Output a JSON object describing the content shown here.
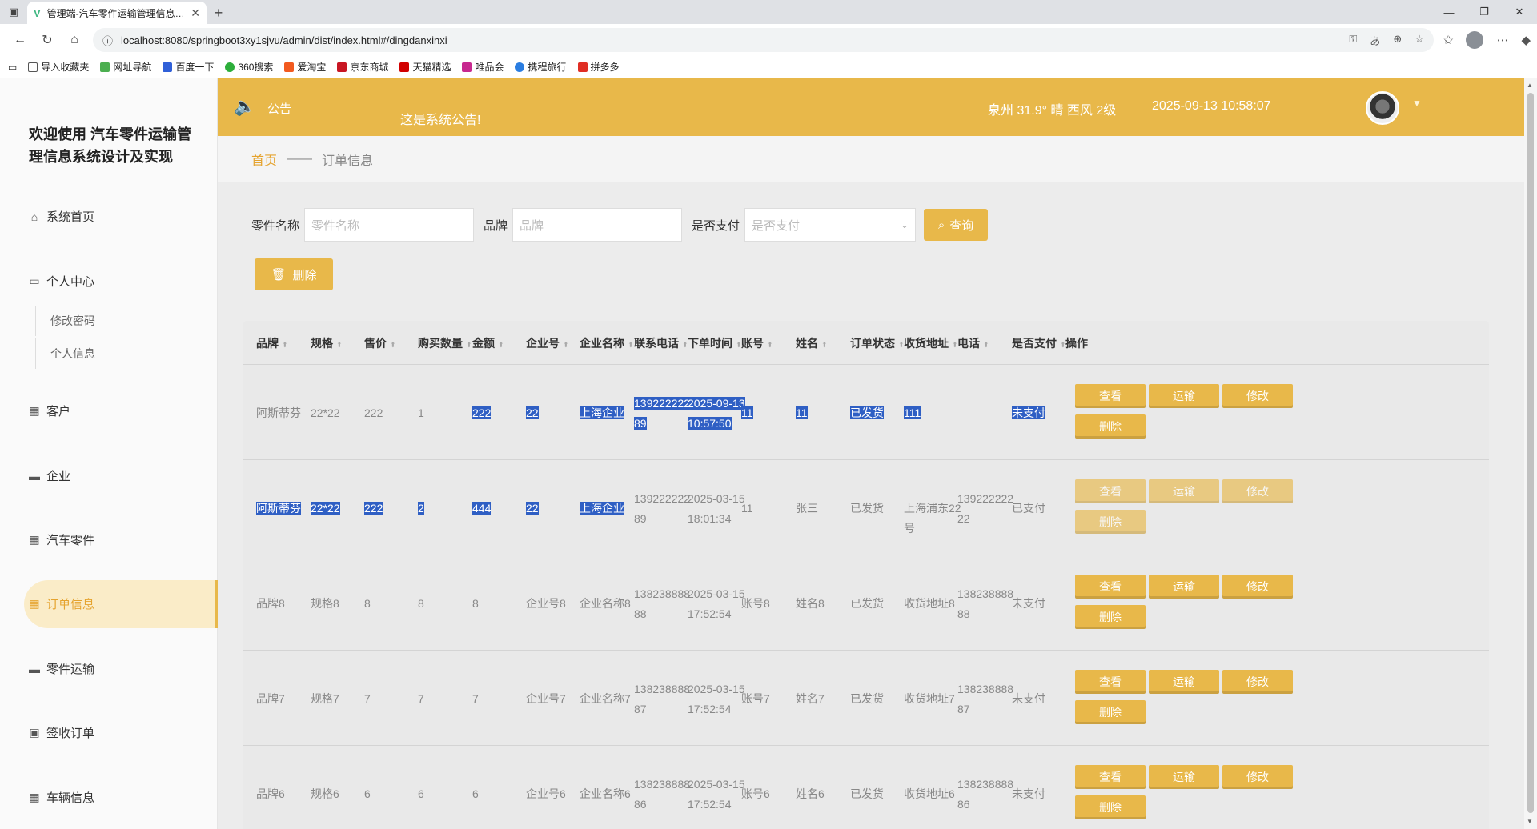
{
  "browser": {
    "tab_title": "管理端-汽车零件运输管理信息系统",
    "url": "localhost:8080/springboot3xy1sjvu/admin/dist/index.html#/dingdanxinxi",
    "bookmarks": [
      "导入收藏夹",
      "网址导航",
      "百度一下",
      "360搜索",
      "爱淘宝",
      "京东商城",
      "天猫精选",
      "唯品会",
      "携程旅行",
      "拼多多"
    ]
  },
  "sidebar": {
    "brand": "欢迎使用 汽车零件运输管理信息系统设计及实现",
    "home": "系统首页",
    "personal": "个人中心",
    "sub": [
      "修改密码",
      "个人信息"
    ],
    "items": [
      "客户",
      "企业",
      "汽车零件",
      "订单信息",
      "零件运输",
      "签收订单",
      "车辆信息"
    ]
  },
  "topbar": {
    "notice_label": "公告",
    "notice_text": "这是系统公告!",
    "weather": "泉州  31.9°  晴  西风  2级",
    "datetime": "2025-09-13 10:58:07"
  },
  "breadcrumb": {
    "home": "首页",
    "sep": "——",
    "current": "订单信息"
  },
  "search": {
    "part_label": "零件名称",
    "part_placeholder": "零件名称",
    "brand_label": "品牌",
    "brand_placeholder": "品牌",
    "paid_label": "是否支付",
    "paid_placeholder": "是否支付",
    "query_btn": "查询",
    "delete_btn": "删除"
  },
  "table": {
    "columns": [
      "品牌",
      "规格",
      "售价",
      "购买数量",
      "金额",
      "企业号",
      "企业名称",
      "联系电话",
      "下单时间",
      "账号",
      "姓名",
      "订单状态",
      "收货地址",
      "电话",
      "是否支付",
      "操作"
    ],
    "rows": [
      [
        "阿斯蒂芬",
        "22*22",
        "222",
        "1",
        "222",
        "22",
        "上海企业",
        "13922222289",
        "2025-09-13 10:57:50",
        "11",
        "11",
        "已发货",
        "111",
        "",
        "未支付"
      ],
      [
        "阿斯蒂芬",
        "22*22",
        "222",
        "2",
        "444",
        "22",
        "上海企业",
        "13922222289",
        "2025-03-15 18:01:34",
        "11",
        "张三",
        "已发货",
        "上海浦东22号",
        "13922222222",
        "已支付"
      ],
      [
        "品牌8",
        "规格8",
        "8",
        "8",
        "8",
        "企业号8",
        "企业名称8",
        "13823888888",
        "2025-03-15 17:52:54",
        "账号8",
        "姓名8",
        "已发货",
        "收货地址8",
        "13823888888",
        "未支付"
      ],
      [
        "品牌7",
        "规格7",
        "7",
        "7",
        "7",
        "企业号7",
        "企业名称7",
        "13823888887",
        "2025-03-15 17:52:54",
        "账号7",
        "姓名7",
        "已发货",
        "收货地址7",
        "13823888887",
        "未支付"
      ],
      [
        "品牌6",
        "规格6",
        "6",
        "6",
        "6",
        "企业号6",
        "企业名称6",
        "13823888886",
        "2025-03-15 17:52:54",
        "账号6",
        "姓名6",
        "已发货",
        "收货地址6",
        "13823888886",
        "未支付"
      ]
    ],
    "actions": [
      "查看",
      "运输",
      "修改",
      "删除"
    ]
  },
  "colors": {
    "accent": "#e8b84a",
    "selection": "#2f5fc4",
    "active_menu_bg": "#faecc8"
  }
}
